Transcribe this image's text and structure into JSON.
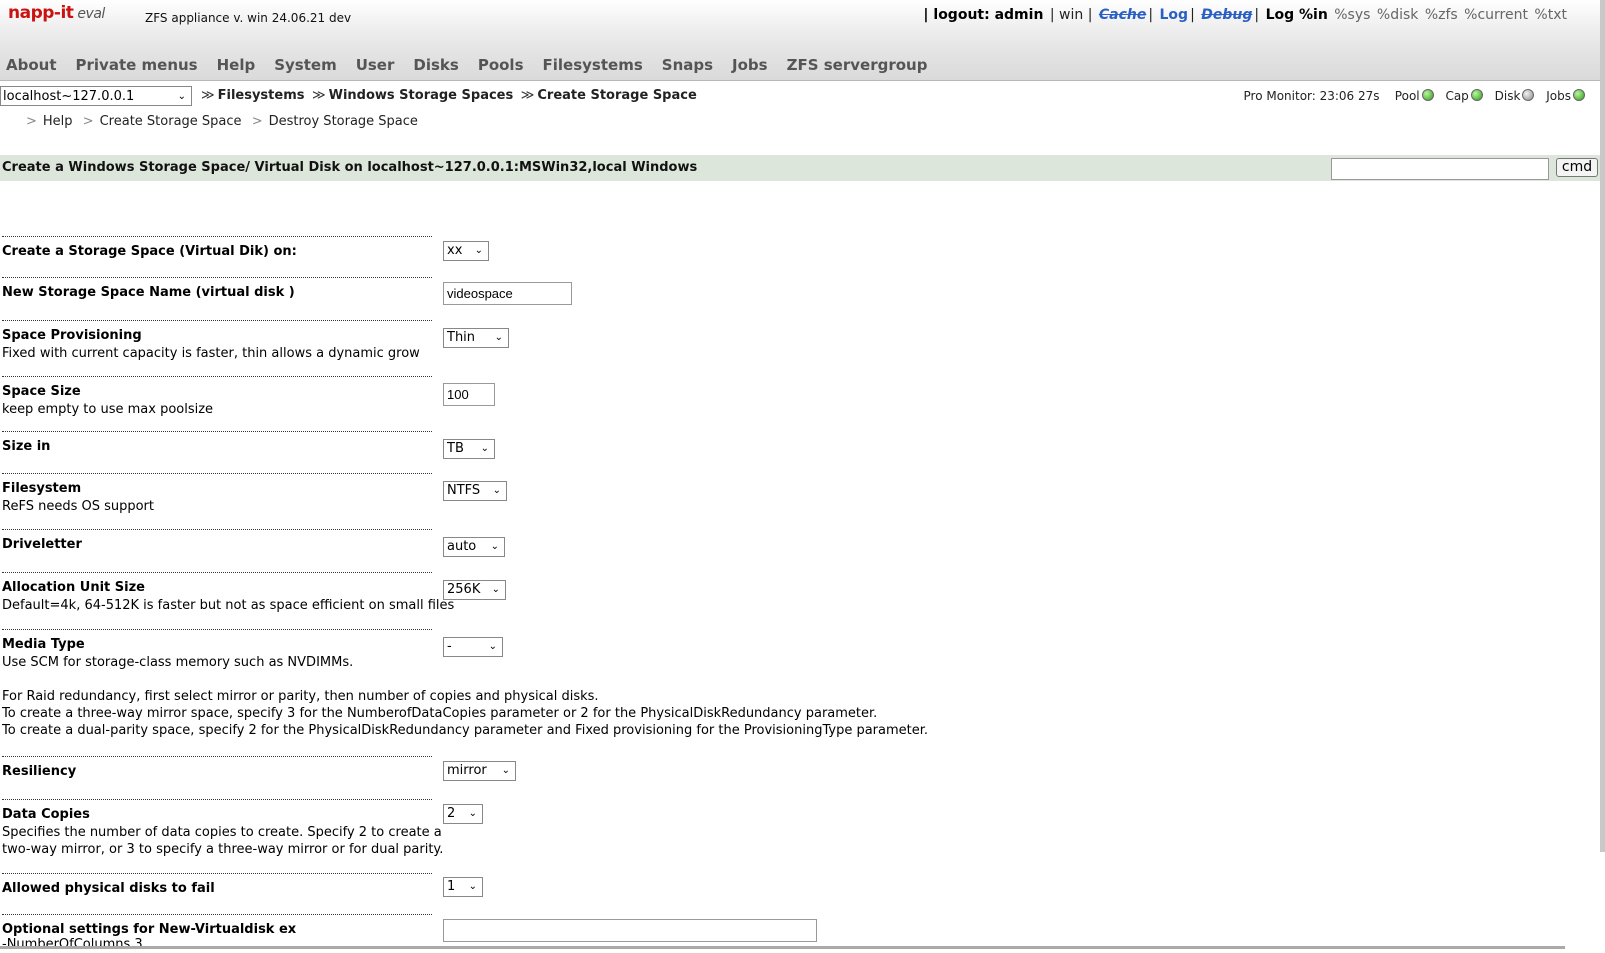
{
  "header": {
    "logo": "napp-it",
    "logo_edition": "eval",
    "app_version": "ZFS appliance v. win 24.06.21 dev",
    "links": {
      "logout": "| logout: admin",
      "win": "| win |",
      "cache": "Cache",
      "log": "Log",
      "debug": "Debug",
      "logpin": "Log %in",
      "sys": "%sys",
      "disk": "%disk",
      "zfs": "%zfs",
      "current": "%current",
      "txt": "%txt"
    }
  },
  "nav": [
    "About",
    "Private menus",
    "Help",
    "System",
    "User",
    "Disks",
    "Pools",
    "Filesystems",
    "Snaps",
    "Jobs",
    "ZFS servergroup"
  ],
  "breadcrumb": {
    "host": "localhost~127.0.0.1",
    "items": [
      "Filesystems",
      "Windows Storage Spaces",
      "Create Storage Space"
    ]
  },
  "monitor": {
    "label": "Pro Monitor: 23:06 27s",
    "pool": "Pool",
    "cap": "Cap",
    "disk": "Disk",
    "jobs": "Jobs",
    "colors": {
      "green": "#2c9b14",
      "grey": "#8a8a8a"
    }
  },
  "sublinks": [
    "Help",
    "Create Storage Space",
    "Destroy Storage Space"
  ],
  "title": "Create a Windows Storage Space/ Virtual Disk on localhost~127.0.0.1:MSWin32,local Windows",
  "cmd": {
    "value": "",
    "button": "cmd"
  },
  "form": {
    "create_on": {
      "label": "Create a Storage Space (Virtual Dik) on:",
      "value": "xx"
    },
    "name": {
      "label": "New Storage Space Name (virtual disk )",
      "value": "videospace"
    },
    "provisioning": {
      "label": "Space Provisioning",
      "desc": "Fixed with current capacity is faster, thin allows a dynamic grow",
      "value": "Thin"
    },
    "size": {
      "label": "Space Size",
      "desc": "keep empty to use max poolsize",
      "value": "100"
    },
    "size_in": {
      "label": "Size in",
      "value": "TB"
    },
    "filesystem": {
      "label": "Filesystem",
      "desc": "ReFS needs OS support",
      "value": "NTFS"
    },
    "driveletter": {
      "label": "Driveletter",
      "value": "auto"
    },
    "allocation": {
      "label": "Allocation Unit Size",
      "desc": "Default=4k, 64-512K is faster but not as space efficient on small files",
      "value": "256K"
    },
    "media": {
      "label": "Media Type",
      "desc": "Use SCM for storage-class memory such as NVDIMMs.",
      "value": "-"
    },
    "note": [
      "For Raid redundancy, first select mirror or parity, then number of copies and physical disks.",
      "To create a three-way mirror space, specify 3 for the NumberofDataCopies parameter or 2 for the PhysicalDiskRedundancy parameter.",
      "To create a dual-parity space, specify 2 for the PhysicalDiskRedundancy parameter and Fixed provisioning for the ProvisioningType parameter."
    ],
    "resiliency": {
      "label": "Resiliency",
      "value": "mirror"
    },
    "copies": {
      "label": "Data Copies",
      "desc1": "Specifies the number of data copies to create. Specify 2 to create a",
      "desc2": "two-way mirror, or 3 to specify a three-way mirror or for dual parity.",
      "value": "2"
    },
    "fail": {
      "label": "Allowed physical disks to fail",
      "value": "1"
    },
    "optional": {
      "label": "Optional settings for New-Virtualdisk ex",
      "desc": "-NumberOfColumns 3",
      "value": ""
    }
  }
}
